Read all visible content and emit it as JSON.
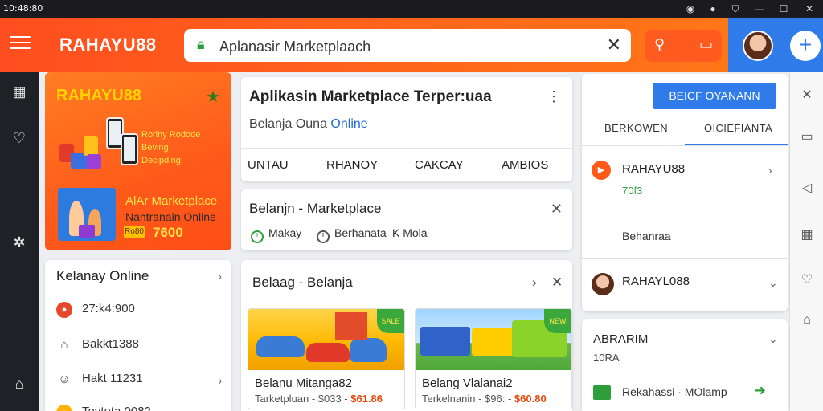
{
  "titlebar": {
    "time": "10:48:80"
  },
  "header": {
    "brand": "RAHAYU88",
    "search_value": "Aplanasir Marketplaach"
  },
  "promo": {
    "brand": "RAHAYU88",
    "lines": [
      "Roriny Rodode",
      "Beving",
      "Decipding"
    ],
    "title": "AlAr Marketplace",
    "subtitle": "Nantranain Online",
    "badge": "Ro80",
    "price": "7600"
  },
  "leftlist": {
    "header": "Kelanay Online",
    "items": [
      "27:k4:900",
      "Bakkt1388",
      "Hakt 11231",
      "Tevteta 0082"
    ]
  },
  "main": {
    "title": "Aplikasin Marketplace Terper:uaa",
    "subtitle_prefix": "Belanja Ouna",
    "subtitle_highlight": "Online",
    "tabs": [
      "UNTAU",
      "RHANOY",
      "CAKCAY",
      "AMBIOS"
    ]
  },
  "marketplace_card": {
    "title": "Belanjn - Marketplace",
    "options": [
      "Makay",
      "Berhanata",
      "K Mola"
    ]
  },
  "belanja_card": {
    "title": "Belaag - Belanja",
    "tiles": [
      {
        "title": "Belanu Mitanga82",
        "desc": "Tarketpluan - $033 -",
        "price": "$61.86",
        "tag": "SALE"
      },
      {
        "title": "Belang Vlalanai2",
        "desc": "Terkelnanin - $96: -",
        "price": "$60.80",
        "tag": "NEW"
      }
    ]
  },
  "right_panel": {
    "button": "BEICF OYANANN",
    "tabs": [
      "BERKOWEN",
      "OICIEFIANTA"
    ],
    "rows": [
      {
        "name": "RAHAYU88",
        "sub": "70f3",
        "extra": "Behanraa"
      },
      {
        "name": "RAHAYL088"
      }
    ],
    "abra": {
      "name": "ABRARIM",
      "sub": "10RA",
      "footer": "Rekahassi · MOlamp"
    }
  },
  "colors": {
    "brand_orange": "#ff5a1a",
    "accent_blue": "#2f7bea",
    "success_green": "#2e9e3a"
  }
}
